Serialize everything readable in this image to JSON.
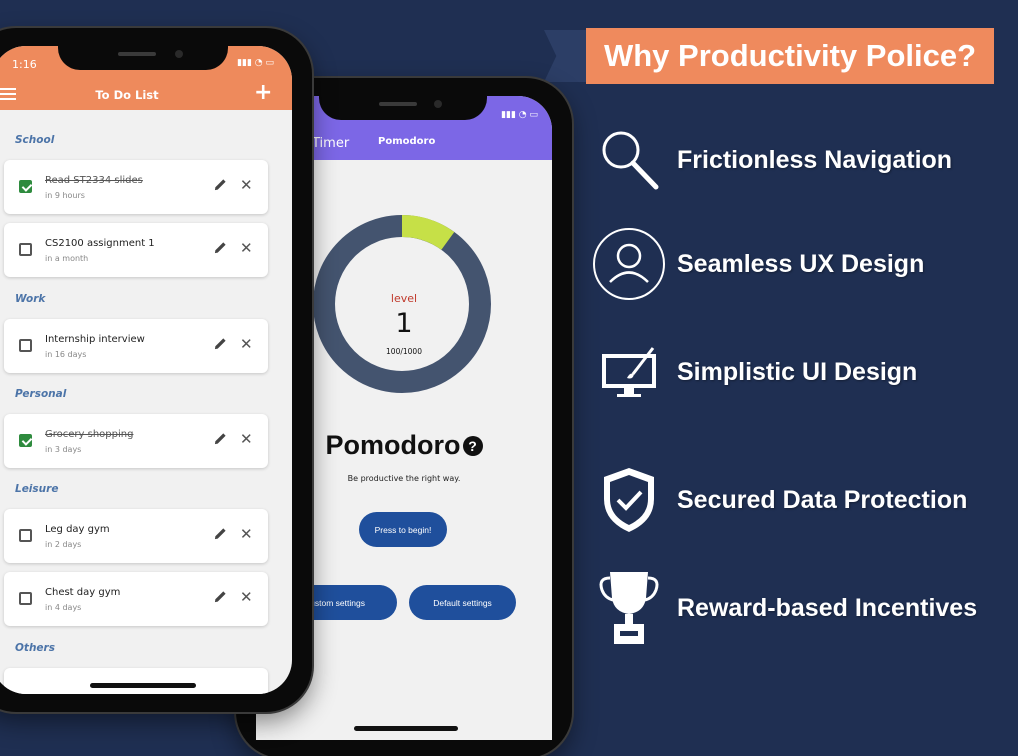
{
  "banner": {
    "title": "Why Productivity Police?"
  },
  "features": [
    {
      "icon": "magnifier-icon",
      "label": "Frictionless Navigation"
    },
    {
      "icon": "user-circle-icon",
      "label": "Seamless UX Design"
    },
    {
      "icon": "monitor-brush-icon",
      "label": "Simplistic UI Design"
    },
    {
      "icon": "shield-check-icon",
      "label": "Secured Data Protection"
    },
    {
      "icon": "trophy-icon",
      "label": "Reward-based Incentives"
    }
  ],
  "todo_app": {
    "time": "1:16",
    "title": "To Do List",
    "sections": [
      {
        "name": "School",
        "tasks": [
          {
            "title": "Read ST2334 slides",
            "due": "in 9 hours",
            "done": true
          },
          {
            "title": "CS2100 assignment 1",
            "due": "in a month",
            "done": false
          }
        ]
      },
      {
        "name": "Work",
        "tasks": [
          {
            "title": "Internship interview",
            "due": "in 16 days",
            "done": false
          }
        ]
      },
      {
        "name": "Personal",
        "tasks": [
          {
            "title": "Grocery shopping",
            "due": "in 3 days",
            "done": true
          }
        ]
      },
      {
        "name": "Leisure",
        "tasks": [
          {
            "title": "Leg day gym",
            "due": "in 2 days",
            "done": false
          },
          {
            "title": "Chest day gym",
            "due": "in 4 days",
            "done": false
          }
        ]
      },
      {
        "name": "Others",
        "tasks": []
      }
    ]
  },
  "pomodoro_app": {
    "tabs": [
      "Timer",
      "Pomodoro"
    ],
    "level_label": "level",
    "level_value": "1",
    "progress_text": "100/1000",
    "progress_fraction": 0.1,
    "title": "Pomodoro",
    "help_glyph": "?",
    "subtitle": "Be productive the right way.",
    "start_button": "Press to begin!",
    "custom_button": "Custom settings",
    "default_button": "Default settings"
  },
  "colors": {
    "background": "#1f2f52",
    "banner": "#ef8a5d",
    "todo_header": "#ee8a5c",
    "pomodoro_header": "#7c67e6",
    "ring_track": "#44546f",
    "ring_progress": "#c6e047",
    "button_blue": "#1f4f9c",
    "check_green": "#2e8b3e"
  }
}
